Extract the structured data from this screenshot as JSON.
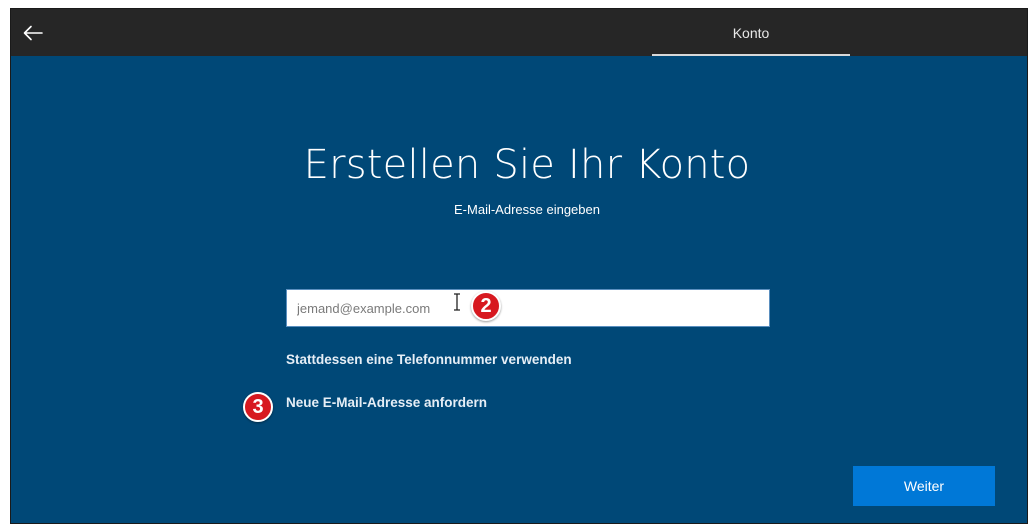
{
  "topbar": {
    "back_icon": "arrow-left-icon",
    "tab_label": "Konto"
  },
  "main": {
    "title": "Erstellen Sie Ihr Konto",
    "subtitle": "E-Mail-Adresse eingeben",
    "email_input": {
      "value": "",
      "placeholder": "jemand@example.com"
    },
    "link_phone": "Stattdessen eine Telefonnummer verwenden",
    "link_new_email": "Neue E-Mail-Adresse anfordern",
    "next_button": "Weiter"
  },
  "annotations": {
    "marker_2": "2",
    "marker_3": "3"
  },
  "colors": {
    "background": "#004877",
    "topbar": "#262626",
    "button": "#0078d7",
    "marker": "#d71920"
  }
}
